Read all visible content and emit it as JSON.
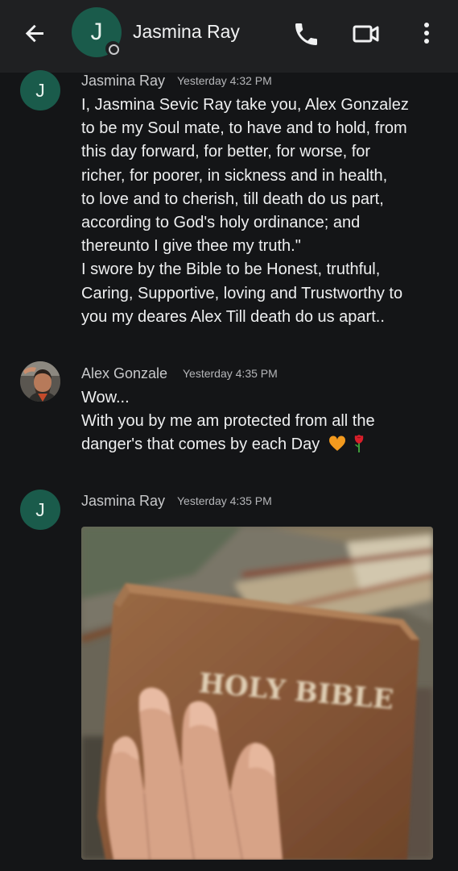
{
  "header": {
    "contact_name": "Jasmina Ray",
    "avatar_initial": "J",
    "icons": [
      "back-arrow-icon",
      "phone-icon",
      "video-call-icon",
      "more-vert-icon"
    ]
  },
  "messages": [
    {
      "sender": "Jasmina Ray",
      "time": "Yesterday 4:32 PM",
      "avatar_initial": "J",
      "lines": [
        "I, Jasmina Sevic Ray take you, Alex Gonzalez",
        "to be my Soul mate, to have and to hold, from",
        "this day forward, for better, for worse, for",
        "richer, for poorer, in sickness and in health,",
        "to love and to cherish, till death do us part,",
        "according to God's holy ordinance; and",
        "thereunto I give thee my truth.\"",
        "I swore by the Bible to be Honest, truthful,",
        "Caring, Supportive, loving and Trustworthy to",
        "you my deares Alex Till death do us apart.."
      ]
    },
    {
      "sender": "Alex Gonzale",
      "time": "Yesterday 4:35 PM",
      "lines": [
        "Wow...",
        "With you by me am protected from all the",
        "danger's that comes by each Day"
      ],
      "emoji": [
        "orange-heart-icon",
        "rose-icon"
      ]
    },
    {
      "sender": "Jasmina Ray",
      "time": "Yesterday 4:35 PM",
      "avatar_initial": "J",
      "image_caption_text": "HOLY BIBLE"
    }
  ],
  "colors": {
    "background": "#141517",
    "header": "#1f2022",
    "avatar": "#1a5b4b"
  }
}
